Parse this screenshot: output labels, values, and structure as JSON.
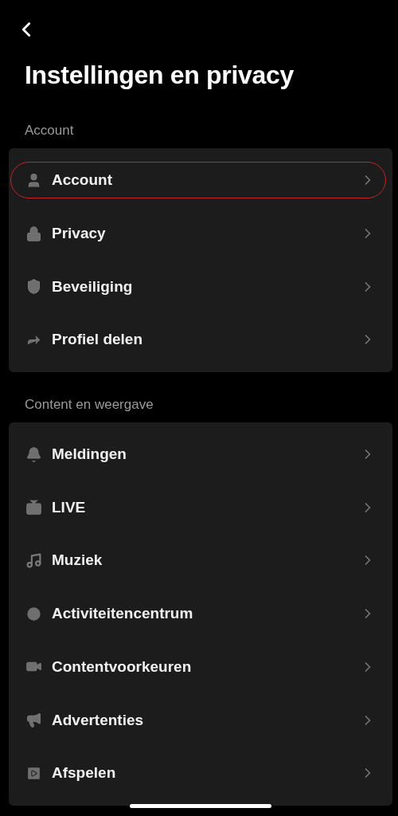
{
  "header": {
    "title": "Instellingen en privacy"
  },
  "sections": [
    {
      "label": "Account",
      "items": [
        {
          "label": "Account",
          "highlighted": true
        },
        {
          "label": "Privacy",
          "highlighted": false
        },
        {
          "label": "Beveiliging",
          "highlighted": false
        },
        {
          "label": "Profiel delen",
          "highlighted": false
        }
      ]
    },
    {
      "label": "Content en weergave",
      "items": [
        {
          "label": "Meldingen",
          "highlighted": false
        },
        {
          "label": "LIVE",
          "highlighted": false
        },
        {
          "label": "Muziek",
          "highlighted": false
        },
        {
          "label": "Activiteitencentrum",
          "highlighted": false
        },
        {
          "label": "Contentvoorkeuren",
          "highlighted": false
        },
        {
          "label": "Advertenties",
          "highlighted": false
        },
        {
          "label": "Afspelen",
          "highlighted": false
        }
      ]
    }
  ]
}
